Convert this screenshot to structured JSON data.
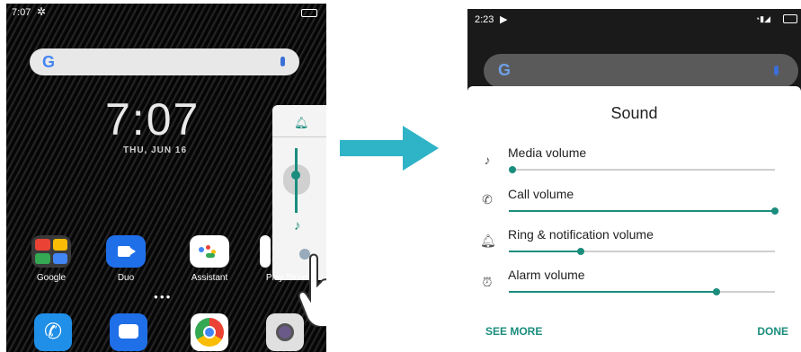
{
  "left_phone": {
    "status_time": "7:07",
    "search_logo": "G",
    "clock": "7:07",
    "date": "THU, JUN 16",
    "apps": [
      {
        "label": "Google",
        "color": "#4a4a4a"
      },
      {
        "label": "Duo",
        "color": "#1f6fe8"
      },
      {
        "label": "Assistant",
        "color": "#ffffff"
      },
      {
        "label": "Play Store",
        "color": "#ffffff"
      }
    ],
    "dock": [
      {
        "name": "phone",
        "color": "#1f8fe8"
      },
      {
        "name": "messages",
        "color": "#1f6fe8"
      },
      {
        "name": "chrome",
        "color": "#ffffff"
      },
      {
        "name": "camera",
        "color": "#e0e0e0"
      }
    ],
    "volume_level": 0.6
  },
  "right_phone": {
    "status_time": "2:23",
    "search_logo": "G",
    "sheet": {
      "title": "Sound",
      "rows": [
        {
          "label": "Media volume",
          "icon": "music-note-icon",
          "glyph": "♪",
          "level": 0.0
        },
        {
          "label": "Call volume",
          "icon": "phone-icon",
          "glyph": "✆",
          "level": 1.0
        },
        {
          "label": "Ring & notification volume",
          "icon": "bell-icon",
          "glyph": "🔔",
          "level": 0.27
        },
        {
          "label": "Alarm volume",
          "icon": "alarm-clock-icon",
          "glyph": "⏰",
          "level": 0.78
        }
      ],
      "see_more": "SEE MORE",
      "done": "DONE"
    }
  },
  "colors": {
    "accent": "#1b8d7d",
    "arrow": "#2fb3c6"
  }
}
